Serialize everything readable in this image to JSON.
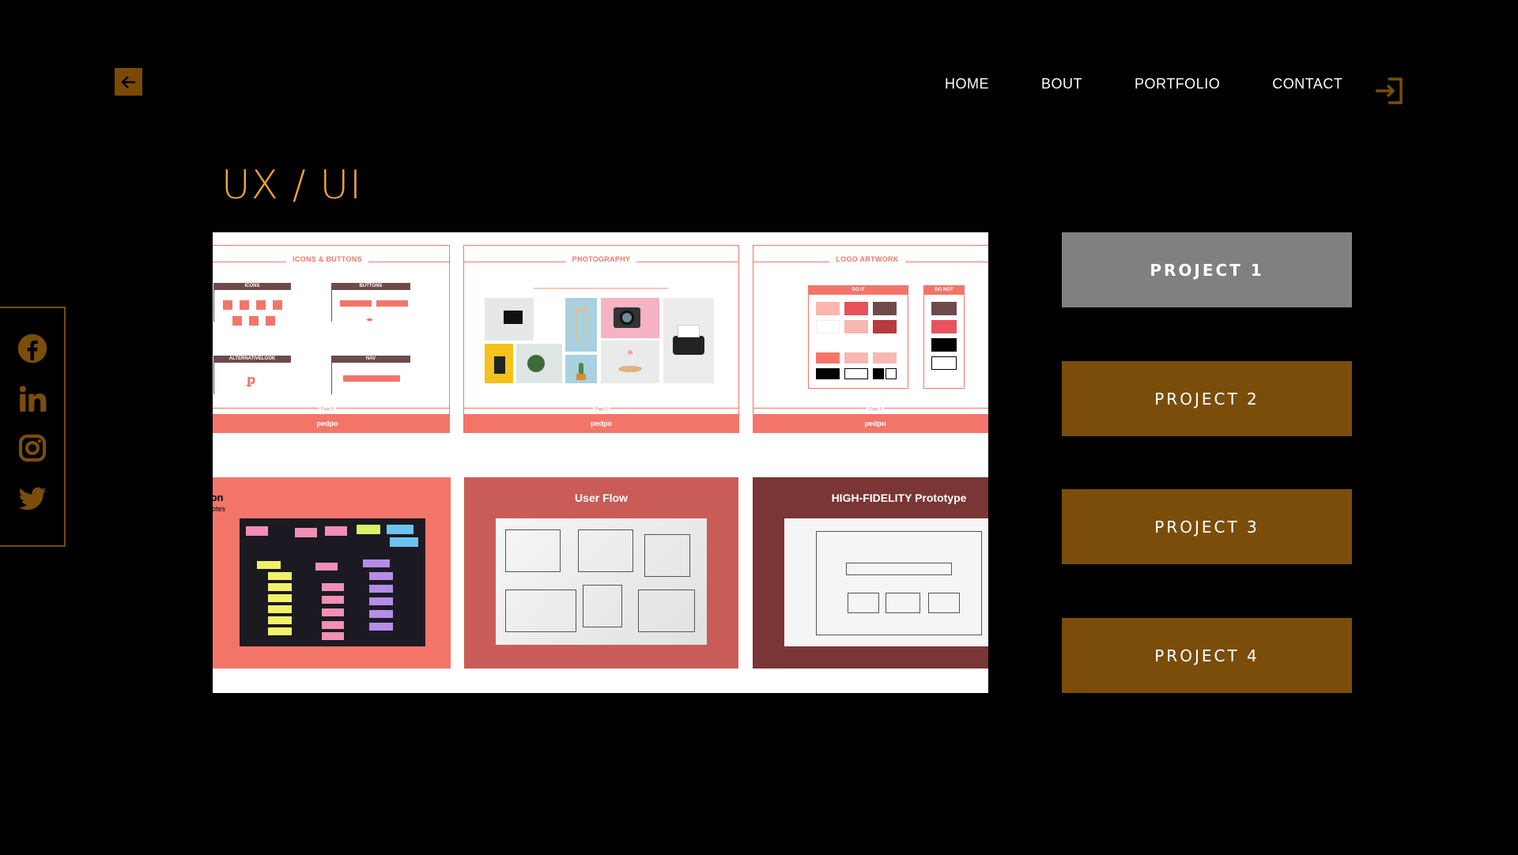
{
  "colors": {
    "accent": "#f0a23b",
    "brown": "#7a4d0b",
    "active_grey": "#808080",
    "coral": "#f3756a"
  },
  "nav": {
    "items": [
      "HOME",
      "BOUT",
      "PORTFOLIO",
      "CONTACT"
    ]
  },
  "page": {
    "title": "UX / UI"
  },
  "gallery": {
    "top": [
      {
        "heading": "ICONS & BUTTONS",
        "sub": [
          "ICONS",
          "BUTTONS",
          "ALTERNATIVELOOK",
          "NAV"
        ],
        "page": "Page 5",
        "footer": "pedpo"
      },
      {
        "heading": "PHOTOGRAPHY",
        "page": "Page 3",
        "footer": "pedpo"
      },
      {
        "heading": "LOGO ARTWORK",
        "sub": [
          "DO IT",
          "DO NOT"
        ],
        "page": "Page 1",
        "footer": "pedpo"
      }
    ],
    "bottom": [
      {
        "caption": "ion",
        "sub": "notes"
      },
      {
        "caption": "User Flow"
      },
      {
        "caption": "HIGH-FIDELITY Prototype"
      }
    ]
  },
  "projects": [
    {
      "label": "PROJECT 1",
      "active": true
    },
    {
      "label": "PROJECT 2",
      "active": false
    },
    {
      "label": "PROJECT 3",
      "active": false
    },
    {
      "label": "PROJECT 4",
      "active": false
    }
  ],
  "icons": [
    "back-arrow-icon",
    "login-icon",
    "facebook-icon",
    "linkedin-icon",
    "instagram-icon",
    "twitter-icon"
  ]
}
